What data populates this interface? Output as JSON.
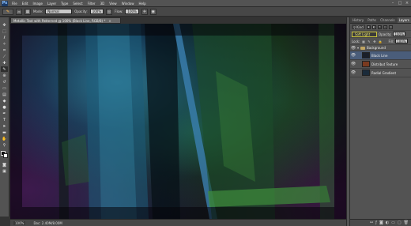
{
  "menubar": {
    "logo": "Ps",
    "items": [
      "File",
      "Edit",
      "Image",
      "Layer",
      "Type",
      "Select",
      "Filter",
      "3D",
      "View",
      "Window",
      "Help"
    ],
    "window_controls": [
      "–",
      "□",
      "×"
    ]
  },
  "options": {
    "tool_preset_icon": "brush-icon",
    "size": "26",
    "mode_label": "Mode:",
    "mode_value": "Normal",
    "opacity_label": "Opacity:",
    "opacity_value": "100%",
    "flow_label": "Flow:",
    "flow_value": "100%"
  },
  "toolbox": {
    "tools": [
      "move",
      "marquee",
      "lasso",
      "quick-select",
      "crop",
      "eyedropper",
      "healing",
      "brush",
      "clone",
      "history",
      "eraser",
      "gradient",
      "blur",
      "dodge",
      "pen",
      "type",
      "path-select",
      "shape",
      "hand",
      "zoom"
    ],
    "active_index": 7,
    "fg_color": "#000000",
    "bg_color": "#ffffff"
  },
  "document": {
    "tab_title": "Metallic Text with Patterned @ 100% (Black Line, RGB/8) *",
    "close": "×"
  },
  "status": {
    "zoom": "100%",
    "doc_info": "Doc: 2.40M/8.00M"
  },
  "panel": {
    "tabs": [
      "History",
      "Paths",
      "Channels",
      "Layers"
    ],
    "active_tab": 3,
    "kind_label": "Kind",
    "blend_mode": "Soft Light",
    "opacity_label": "Opacity:",
    "opacity_value": "100%",
    "lock_label": "Lock:",
    "fill_label": "Fill:",
    "fill_value": "100%",
    "group_name": "Background",
    "layers": [
      {
        "name": "Black Line",
        "selected": true,
        "thumb": "#1a1f2a"
      },
      {
        "name": "Distribut Texture",
        "selected": false,
        "thumb": "#7a3a1f"
      },
      {
        "name": "Radial Gradient",
        "selected": false,
        "thumb": "#1b2b3a"
      }
    ],
    "footer_icons": [
      "link-icon",
      "fx-icon",
      "mask-icon",
      "adjustment-icon",
      "folder-icon",
      "new-layer-icon",
      "trash-icon"
    ]
  }
}
